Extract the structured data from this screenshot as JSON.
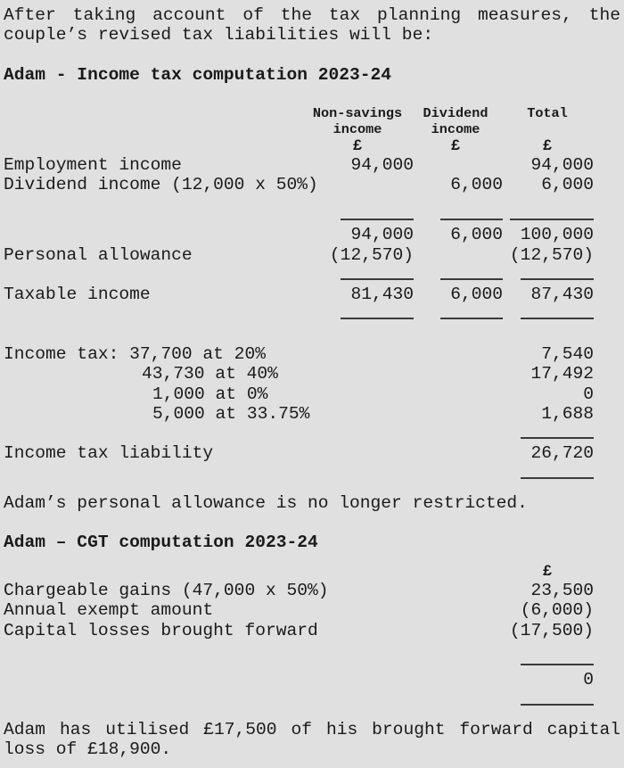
{
  "intro": "After taking account of the tax planning measures, the couple’s revised tax liabilities will be:",
  "income_tax": {
    "heading": "Adam - Income tax computation 2023-24",
    "columns": [
      {
        "label_line1": "Non-savings",
        "label_line2": "income",
        "currency": "£"
      },
      {
        "label_line1": "Dividend",
        "label_line2": "income",
        "currency": "£"
      },
      {
        "label_line1": "Total",
        "label_line2": "",
        "currency": "£"
      }
    ],
    "rows": [
      {
        "label": "Employment income",
        "c1": "94,000",
        "c2": "",
        "c3": "94,000"
      },
      {
        "label": "Dividend income (12,000 x 50%)",
        "c1": "",
        "c2": "6,000",
        "c3": "6,000"
      },
      {
        "label": "",
        "c1": "94,000",
        "c2": "6,000",
        "c3": "100,000"
      },
      {
        "label": "Personal allowance",
        "c1": "(12,570)",
        "c2": "",
        "c3": "(12,570)"
      },
      {
        "label": "Taxable income",
        "c1": "81,430",
        "c2": "6,000",
        "c3": "87,430"
      }
    ],
    "bands": [
      {
        "label": "Income tax: 37,700 at 20%",
        "amount": "7,540"
      },
      {
        "label": "43,730 at 40%",
        "amount": "17,492"
      },
      {
        "label": "1,000 at 0%",
        "amount": "0"
      },
      {
        "label": "5,000 at 33.75%",
        "amount": "1,688"
      }
    ],
    "liability": {
      "label": "Income tax liability",
      "amount": "26,720"
    }
  },
  "note_personal_allowance": "Adam’s personal allowance is no longer restricted.",
  "cgt": {
    "heading": "Adam – CGT computation 2023-24",
    "currency": "£",
    "rows": [
      {
        "label": "Chargeable gains (47,000 x 50%)",
        "amount": "23,500"
      },
      {
        "label": "Annual exempt amount",
        "amount": "(6,000)"
      },
      {
        "label": "Capital losses brought forward",
        "amount": "(17,500)"
      }
    ],
    "total": {
      "label": "",
      "amount": "0"
    }
  },
  "note_capital_loss": "Adam has utilised £17,500 of his brought forward capital loss of £18,900."
}
